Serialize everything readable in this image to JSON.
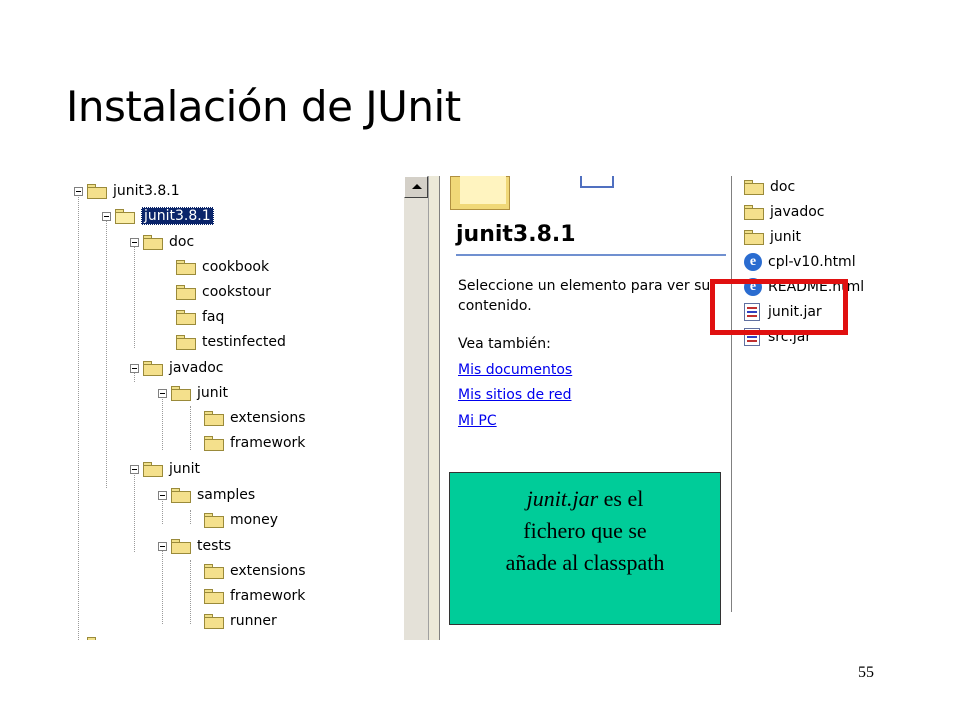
{
  "slide": {
    "title": "Instalación de JUnit",
    "page_number": "55"
  },
  "tree": {
    "items": [
      {
        "label": "junit3.8.1"
      },
      {
        "label": "junit3.8.1",
        "selected": true
      },
      {
        "label": "doc"
      },
      {
        "label": "cookbook"
      },
      {
        "label": "cookstour"
      },
      {
        "label": "faq"
      },
      {
        "label": "testinfected"
      },
      {
        "label": "javadoc"
      },
      {
        "label": "junit"
      },
      {
        "label": "extensions"
      },
      {
        "label": "framework"
      },
      {
        "label": "junit"
      },
      {
        "label": "samples"
      },
      {
        "label": "money"
      },
      {
        "label": "tests"
      },
      {
        "label": "extensions"
      },
      {
        "label": "framework"
      },
      {
        "label": "runner"
      }
    ]
  },
  "webview": {
    "title": "junit3.8.1",
    "description_line1": "Seleccione un elemento para ver su",
    "description_line2": "contenido.",
    "see_also": "Vea también:",
    "links": [
      "Mis documentos",
      "Mis sitios de red",
      "Mi PC"
    ]
  },
  "files": {
    "items": [
      {
        "label": "doc",
        "icon": "folder-icon"
      },
      {
        "label": "javadoc",
        "icon": "folder-icon"
      },
      {
        "label": "junit",
        "icon": "folder-icon"
      },
      {
        "label": "cpl-v10.html",
        "icon": "ie-html-icon"
      },
      {
        "label": "README.html",
        "icon": "ie-html-icon"
      },
      {
        "label": "junit.jar",
        "icon": "jar-file-icon"
      },
      {
        "label": "src.jar",
        "icon": "jar-file-icon"
      }
    ]
  },
  "callout": {
    "italic_part": "junit.jar",
    "rest_line1": " es el",
    "line2": "fichero que se",
    "line3": "añade al classpath"
  },
  "colors": {
    "callout_bg": "#00cc99",
    "highlight_border": "#e01010",
    "selection_bg": "#0a246a",
    "link": "#0000ee"
  }
}
